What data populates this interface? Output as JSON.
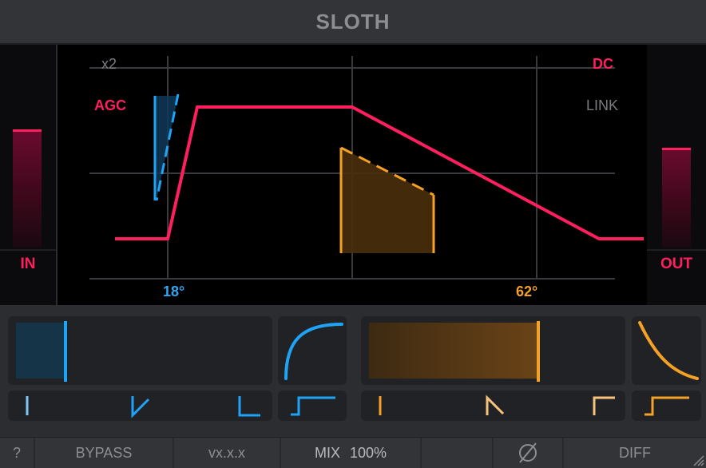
{
  "app": {
    "title": "SLOTH"
  },
  "meters": {
    "in": {
      "label": "IN",
      "level": 0.72
    },
    "out": {
      "label": "OUT",
      "level": 0.65
    }
  },
  "graph": {
    "x2_label": "x2",
    "agc_label": "AGC",
    "dc_label": "DC",
    "link_label": "LINK",
    "left_angle": "18°",
    "right_angle": "62°"
  },
  "controls": {
    "left_slider": {
      "value": 0.2,
      "color": "#1fa3f4"
    },
    "right_slider": {
      "value": 0.68,
      "color": "#f4a125"
    },
    "left_shape_icon": "convex-curve-icon",
    "right_shape_icon": "concave-curve-icon",
    "left_modes": [
      "line-mode-icon",
      "v-mode-icon",
      "corner-mode-icon"
    ],
    "right_modes": [
      "line-mode-icon",
      "peak-mode-icon",
      "corner-mode-icon"
    ],
    "left_step_icon": "step-icon",
    "right_step_icon": "step-icon"
  },
  "footer": {
    "help": "?",
    "bypass": "BYPASS",
    "version": "vx.x.x",
    "mix_label": "MIX",
    "mix_value": "100%",
    "phase_icon": "phase-invert-icon",
    "diff": "DIFF"
  },
  "colors": {
    "accent_red": "#ff1f5f",
    "accent_blue": "#1fa3f4",
    "accent_orange": "#f4a125",
    "background": "#2b2d31"
  }
}
